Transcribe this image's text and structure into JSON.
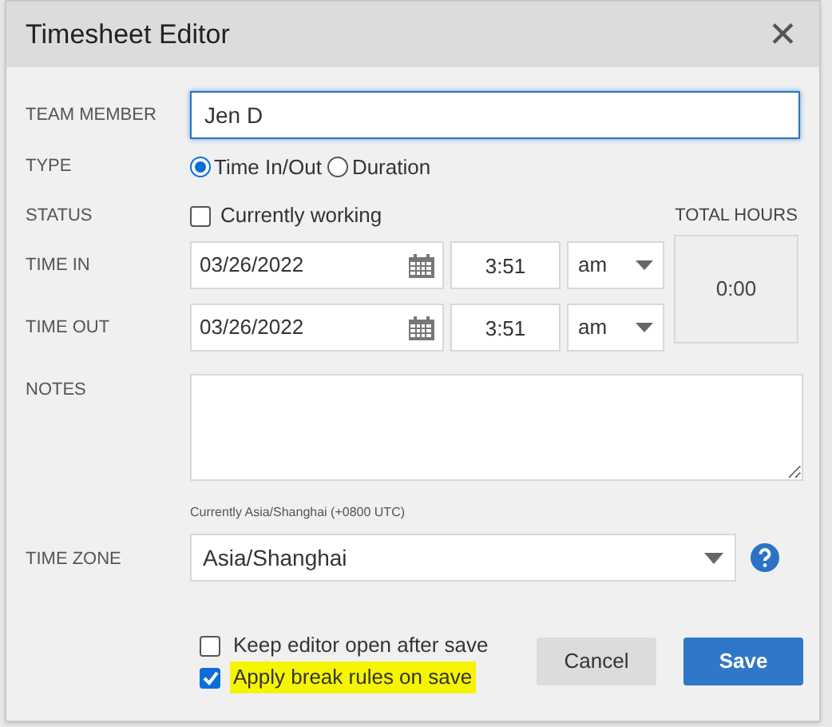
{
  "dialog": {
    "title": "Timesheet Editor",
    "close": "✕"
  },
  "team_member": {
    "label": "TEAM MEMBER",
    "value": "Jen D",
    "focused": true
  },
  "type": {
    "label": "TYPE",
    "options": [
      {
        "label": "Time In/Out",
        "selected": true
      },
      {
        "label": "Duration",
        "selected": false
      }
    ]
  },
  "status": {
    "label": "STATUS",
    "checkbox": {
      "label": "Currently working",
      "checked": false
    }
  },
  "total_hours": {
    "label": "TOTAL HOURS",
    "value": "0:00"
  },
  "times": [
    {
      "label": "TIME IN",
      "date": "03/26/2022",
      "time": "3:51",
      "period": "am"
    },
    {
      "label": "TIME OUT",
      "date": "03/26/2022",
      "time": "3:51",
      "period": "am"
    }
  ],
  "notes": {
    "label": "NOTES"
  },
  "time_zone": {
    "hint": "Currently Asia/Shanghai (+0800 UTC)",
    "label": "TIME ZONE",
    "value": "Asia/Shanghai"
  },
  "options": [
    {
      "label": "Keep editor open after save",
      "checked": false,
      "highlighted": false
    },
    {
      "label": "Apply break rules on save",
      "checked": true,
      "highlighted": true
    }
  ],
  "buttons": [
    {
      "label": "Cancel",
      "kind": "secondary"
    },
    {
      "label": "Save",
      "kind": "primary"
    }
  ]
}
